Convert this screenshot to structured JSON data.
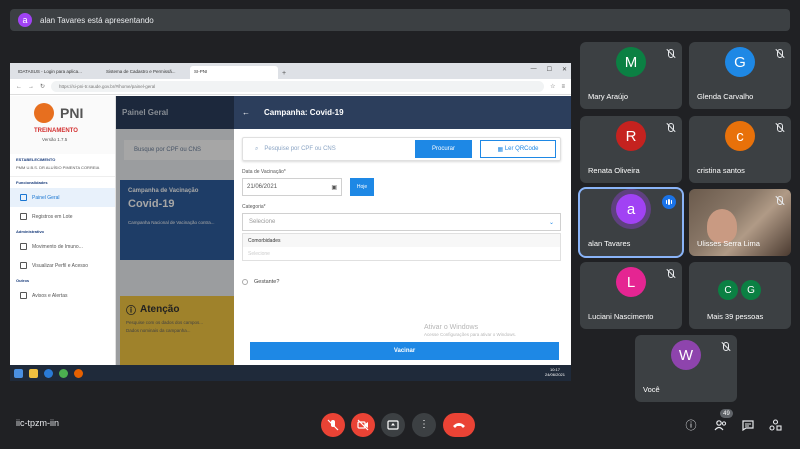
{
  "banner": {
    "avatar_letter": "a",
    "text": "alan Tavares está apresentando"
  },
  "shared_screen": {
    "browser": {
      "tabs": [
        "IDATASUS - Login para aplica...",
        "Sistema de Cadastro e Permissã...",
        "SI-PNI"
      ],
      "url": "https://si-pni-tr.saude.gov.br/#/home/painel-geral"
    },
    "sidebar": {
      "logo": "PNI",
      "env": "TREINAMENTO",
      "version": "Versão 1.7.5",
      "establishment_label": "ESTABELECIMENTO",
      "establishment_name": "PMM U.B.S. DR ALUÍSIO PIMENTA CORREIA",
      "section_features": "Funcionalidades",
      "items": [
        "Painel Geral",
        "Registros em Lote"
      ],
      "section_admin": "Administrativo",
      "admin_items": [
        "Movimento de Imuno...",
        "Visualizar Perfil e Acesso"
      ],
      "section_help": "Outros",
      "help_items": [
        "Avisos e Alertas"
      ]
    },
    "background": {
      "header": "Painel Geral",
      "search_placeholder": "Busque por CPF ou CNS",
      "campaign_card": {
        "label": "Campanha de Vacinação",
        "name": "Covid-19",
        "desc": "Campanha Nacional de Vacinação contra..."
      },
      "attention": {
        "title": "Atenção",
        "line1": "Pesquise com os dados dos campos...",
        "line2": "Dados nominais da campanha..."
      }
    },
    "modal": {
      "title": "Campanha: Covid-19",
      "search_placeholder": "Pesquise por CPF ou CNS",
      "search_button": "Procurar",
      "qr_button": "Ler QRCode",
      "date_label": "Data de Vacinação*",
      "date_value": "21/06/2021",
      "today_button": "Hoje",
      "category_label": "Categoria*",
      "category_placeholder": "Selecione",
      "options": [
        "Comorbidades",
        "Selecione"
      ],
      "pregnant_label": "Gestante?",
      "vaccinate_button": "Vacinar",
      "watermark_line1": "Ativar o Windows",
      "watermark_line2": "Acesse Configurações para ativar o Windows."
    },
    "taskbar": {
      "time": "10:17",
      "date": "24/06/2021"
    }
  },
  "participants": [
    {
      "name": "Mary Araújo",
      "letter": "M",
      "color": "#0b8043"
    },
    {
      "name": "Glenda Carvalho",
      "letter": "G",
      "color": "#1e88e5"
    },
    {
      "name": "Renata Oliveira",
      "letter": "R",
      "color": "#c5221f"
    },
    {
      "name": "cristina santos",
      "letter": "c",
      "color": "#e8710a"
    },
    {
      "name": "alan Tavares",
      "letter": "a",
      "color": "#a142f4"
    },
    {
      "name": "Ulisses Serra Lima",
      "letter": "",
      "color": ""
    },
    {
      "name": "Luciani Nascimento",
      "letter": "L",
      "color": "#e52592"
    },
    {
      "name": "Mais 39 pessoas",
      "letter": "",
      "color": ""
    },
    {
      "name": "Você",
      "letter": "W",
      "color": "#8e44ad"
    }
  ],
  "more_people_letters": [
    "C",
    "G"
  ],
  "more_people_color": "#0b8043",
  "controls": {
    "meeting_code": "iic-tpzm-iin",
    "participants_count": "49"
  }
}
